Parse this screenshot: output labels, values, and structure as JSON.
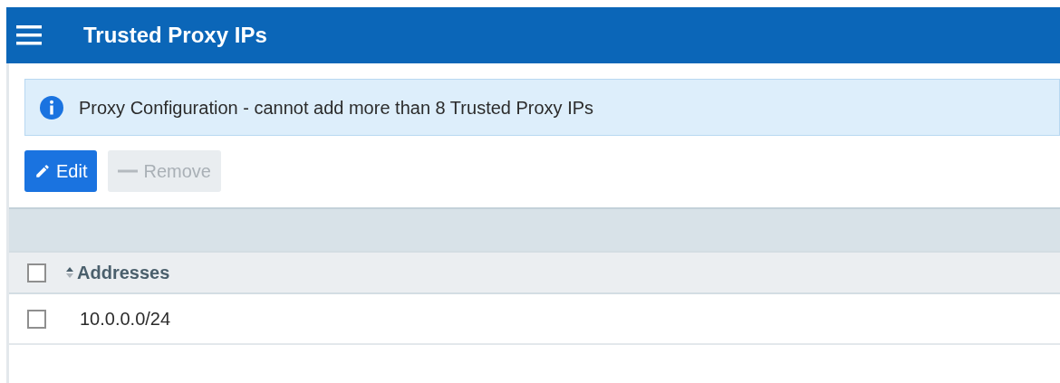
{
  "header": {
    "title": "Trusted Proxy IPs"
  },
  "alert": {
    "text": "Proxy Configuration - cannot add more than 8 Trusted Proxy IPs"
  },
  "buttons": [
    {
      "kind": "edit",
      "label": "Edit",
      "disabled": false
    },
    {
      "kind": "remove",
      "label": "Remove",
      "disabled": true
    }
  ],
  "table": {
    "select_all": {
      "checked": false
    },
    "columns": [
      {
        "label": "Addresses"
      }
    ],
    "rows": [
      {
        "checked": false,
        "cells": [
          "10.0.0.0/24"
        ]
      }
    ]
  }
}
